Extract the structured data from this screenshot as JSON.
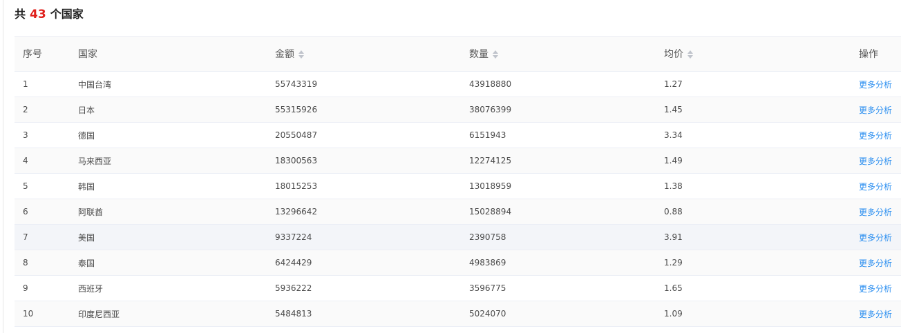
{
  "title": {
    "prefix": "共",
    "count": "43",
    "suffix": "个国家"
  },
  "colors": {
    "accent_count": "#e0201c",
    "link": "#2a8ef0"
  },
  "table": {
    "headers": {
      "index": "序号",
      "country": "国家",
      "amount": "金额",
      "quantity": "数量",
      "avg_price": "均价",
      "action": "操作"
    },
    "sortable": [
      "amount",
      "quantity",
      "avg_price"
    ],
    "rows": [
      {
        "index": "1",
        "country": "中国台湾",
        "amount": "55743319",
        "quantity": "43918880",
        "avg_price": "1.27",
        "action": "更多分析"
      },
      {
        "index": "2",
        "country": "日本",
        "amount": "55315926",
        "quantity": "38076399",
        "avg_price": "1.45",
        "action": "更多分析"
      },
      {
        "index": "3",
        "country": "德国",
        "amount": "20550487",
        "quantity": "6151943",
        "avg_price": "3.34",
        "action": "更多分析"
      },
      {
        "index": "4",
        "country": "马来西亚",
        "amount": "18300563",
        "quantity": "12274125",
        "avg_price": "1.49",
        "action": "更多分析"
      },
      {
        "index": "5",
        "country": "韩国",
        "amount": "18015253",
        "quantity": "13018959",
        "avg_price": "1.38",
        "action": "更多分析"
      },
      {
        "index": "6",
        "country": "阿联酋",
        "amount": "13296642",
        "quantity": "15028894",
        "avg_price": "0.88",
        "action": "更多分析"
      },
      {
        "index": "7",
        "country": "美国",
        "amount": "9337224",
        "quantity": "2390758",
        "avg_price": "3.91",
        "action": "更多分析"
      },
      {
        "index": "8",
        "country": "泰国",
        "amount": "6424429",
        "quantity": "4983869",
        "avg_price": "1.29",
        "action": "更多分析"
      },
      {
        "index": "9",
        "country": "西班牙",
        "amount": "5936222",
        "quantity": "3596775",
        "avg_price": "1.65",
        "action": "更多分析"
      },
      {
        "index": "10",
        "country": "印度尼西亚",
        "amount": "5484813",
        "quantity": "5024070",
        "avg_price": "1.09",
        "action": "更多分析"
      }
    ]
  }
}
